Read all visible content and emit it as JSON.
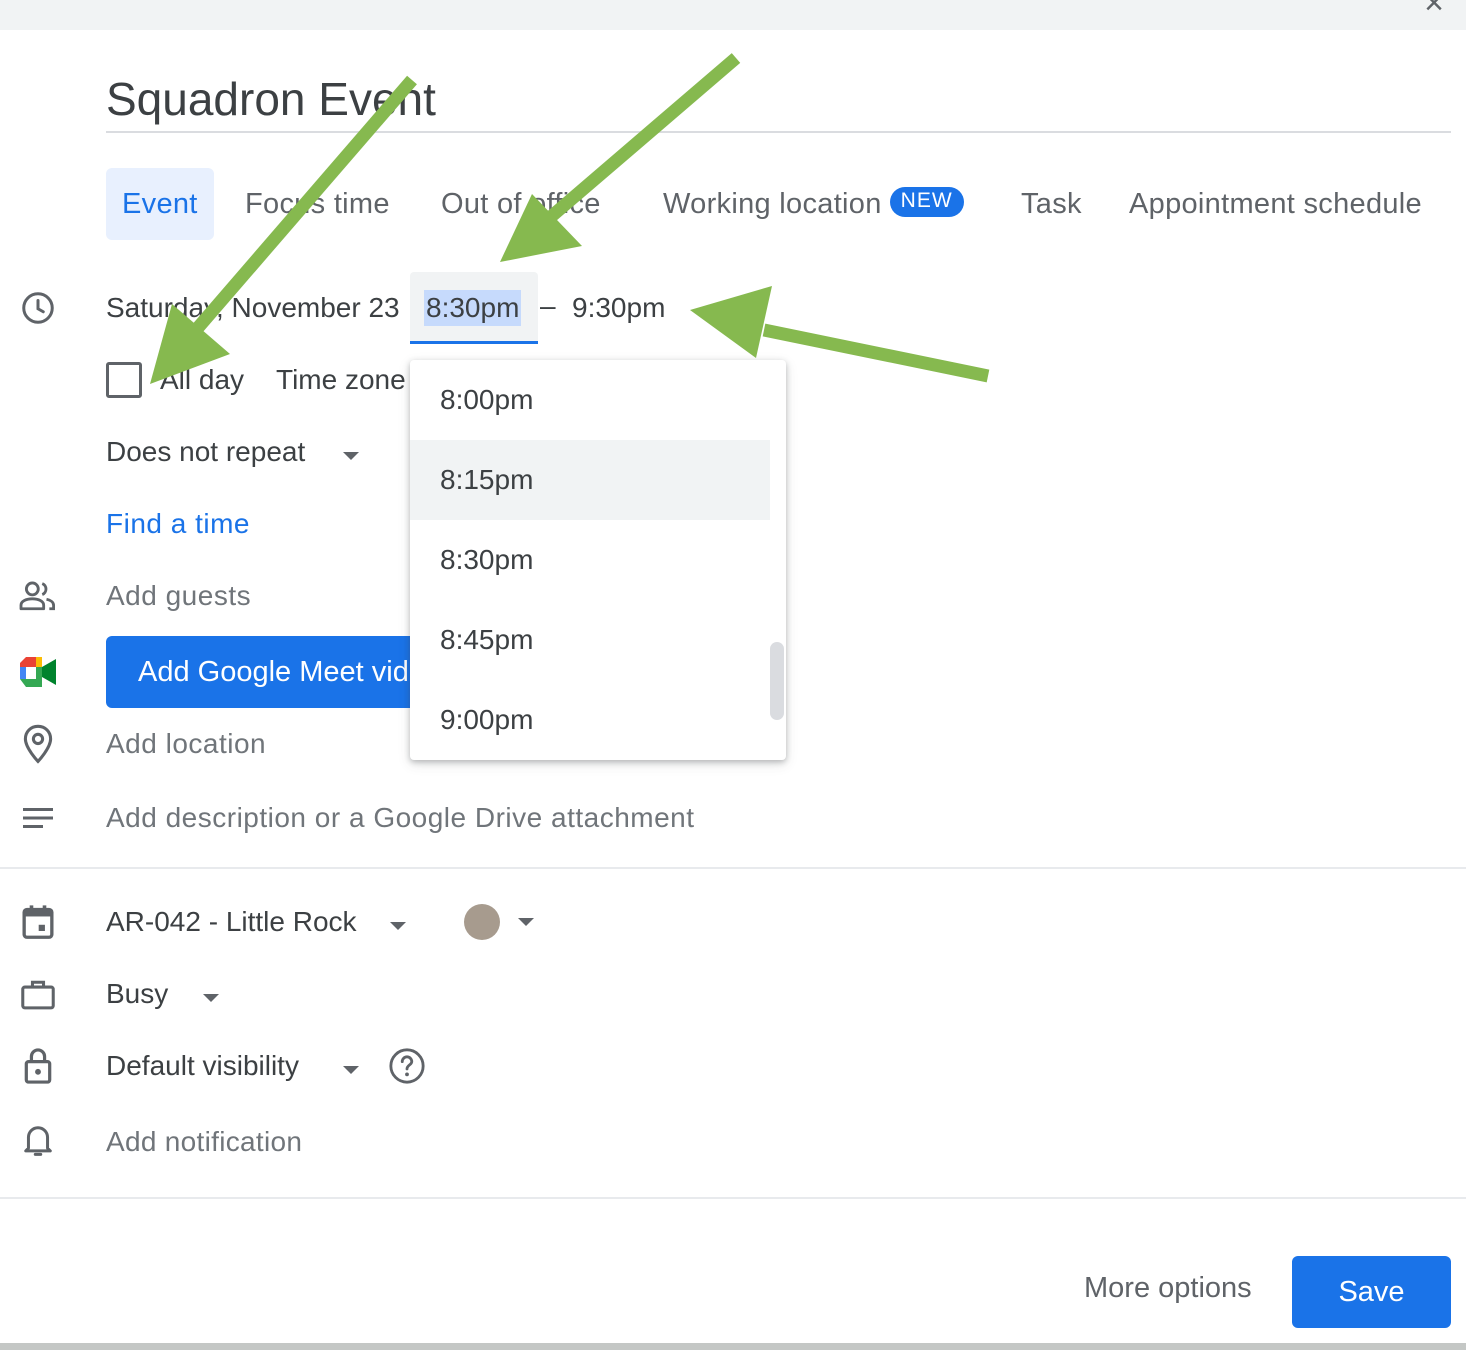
{
  "title": "Squadron Event",
  "tabs": [
    {
      "label": "Event"
    },
    {
      "label": "Focus time"
    },
    {
      "label": "Out of office"
    },
    {
      "label": "Working location",
      "badge": "NEW"
    },
    {
      "label": "Task"
    },
    {
      "label": "Appointment schedule"
    }
  ],
  "datetime": {
    "date": "Saturday, November 23",
    "start": "8:30pm",
    "separator": "–",
    "end": "9:30pm"
  },
  "all_day": {
    "label": "All day",
    "checked": false
  },
  "time_zone": "Time zone",
  "repeat": "Does not repeat",
  "find_time": "Find a time",
  "guests_placeholder": "Add guests",
  "meet_button": "Add Google Meet video conferencing",
  "location_placeholder": "Add location",
  "description_placeholder": "Add description or a Google Drive attachment",
  "time_options": [
    "8:00pm",
    "8:15pm",
    "8:30pm",
    "8:45pm",
    "9:00pm"
  ],
  "hovered_option": "8:15pm",
  "calendar": "AR-042 - Little Rock",
  "event_color": "#a79b8e",
  "availability": "Busy",
  "visibility": "Default visibility",
  "notification": "Add notification",
  "footer": {
    "more_options": "More options",
    "save": "Save"
  },
  "colors": {
    "accent": "#1a73e8",
    "annotation_arrow": "#86b94f"
  }
}
